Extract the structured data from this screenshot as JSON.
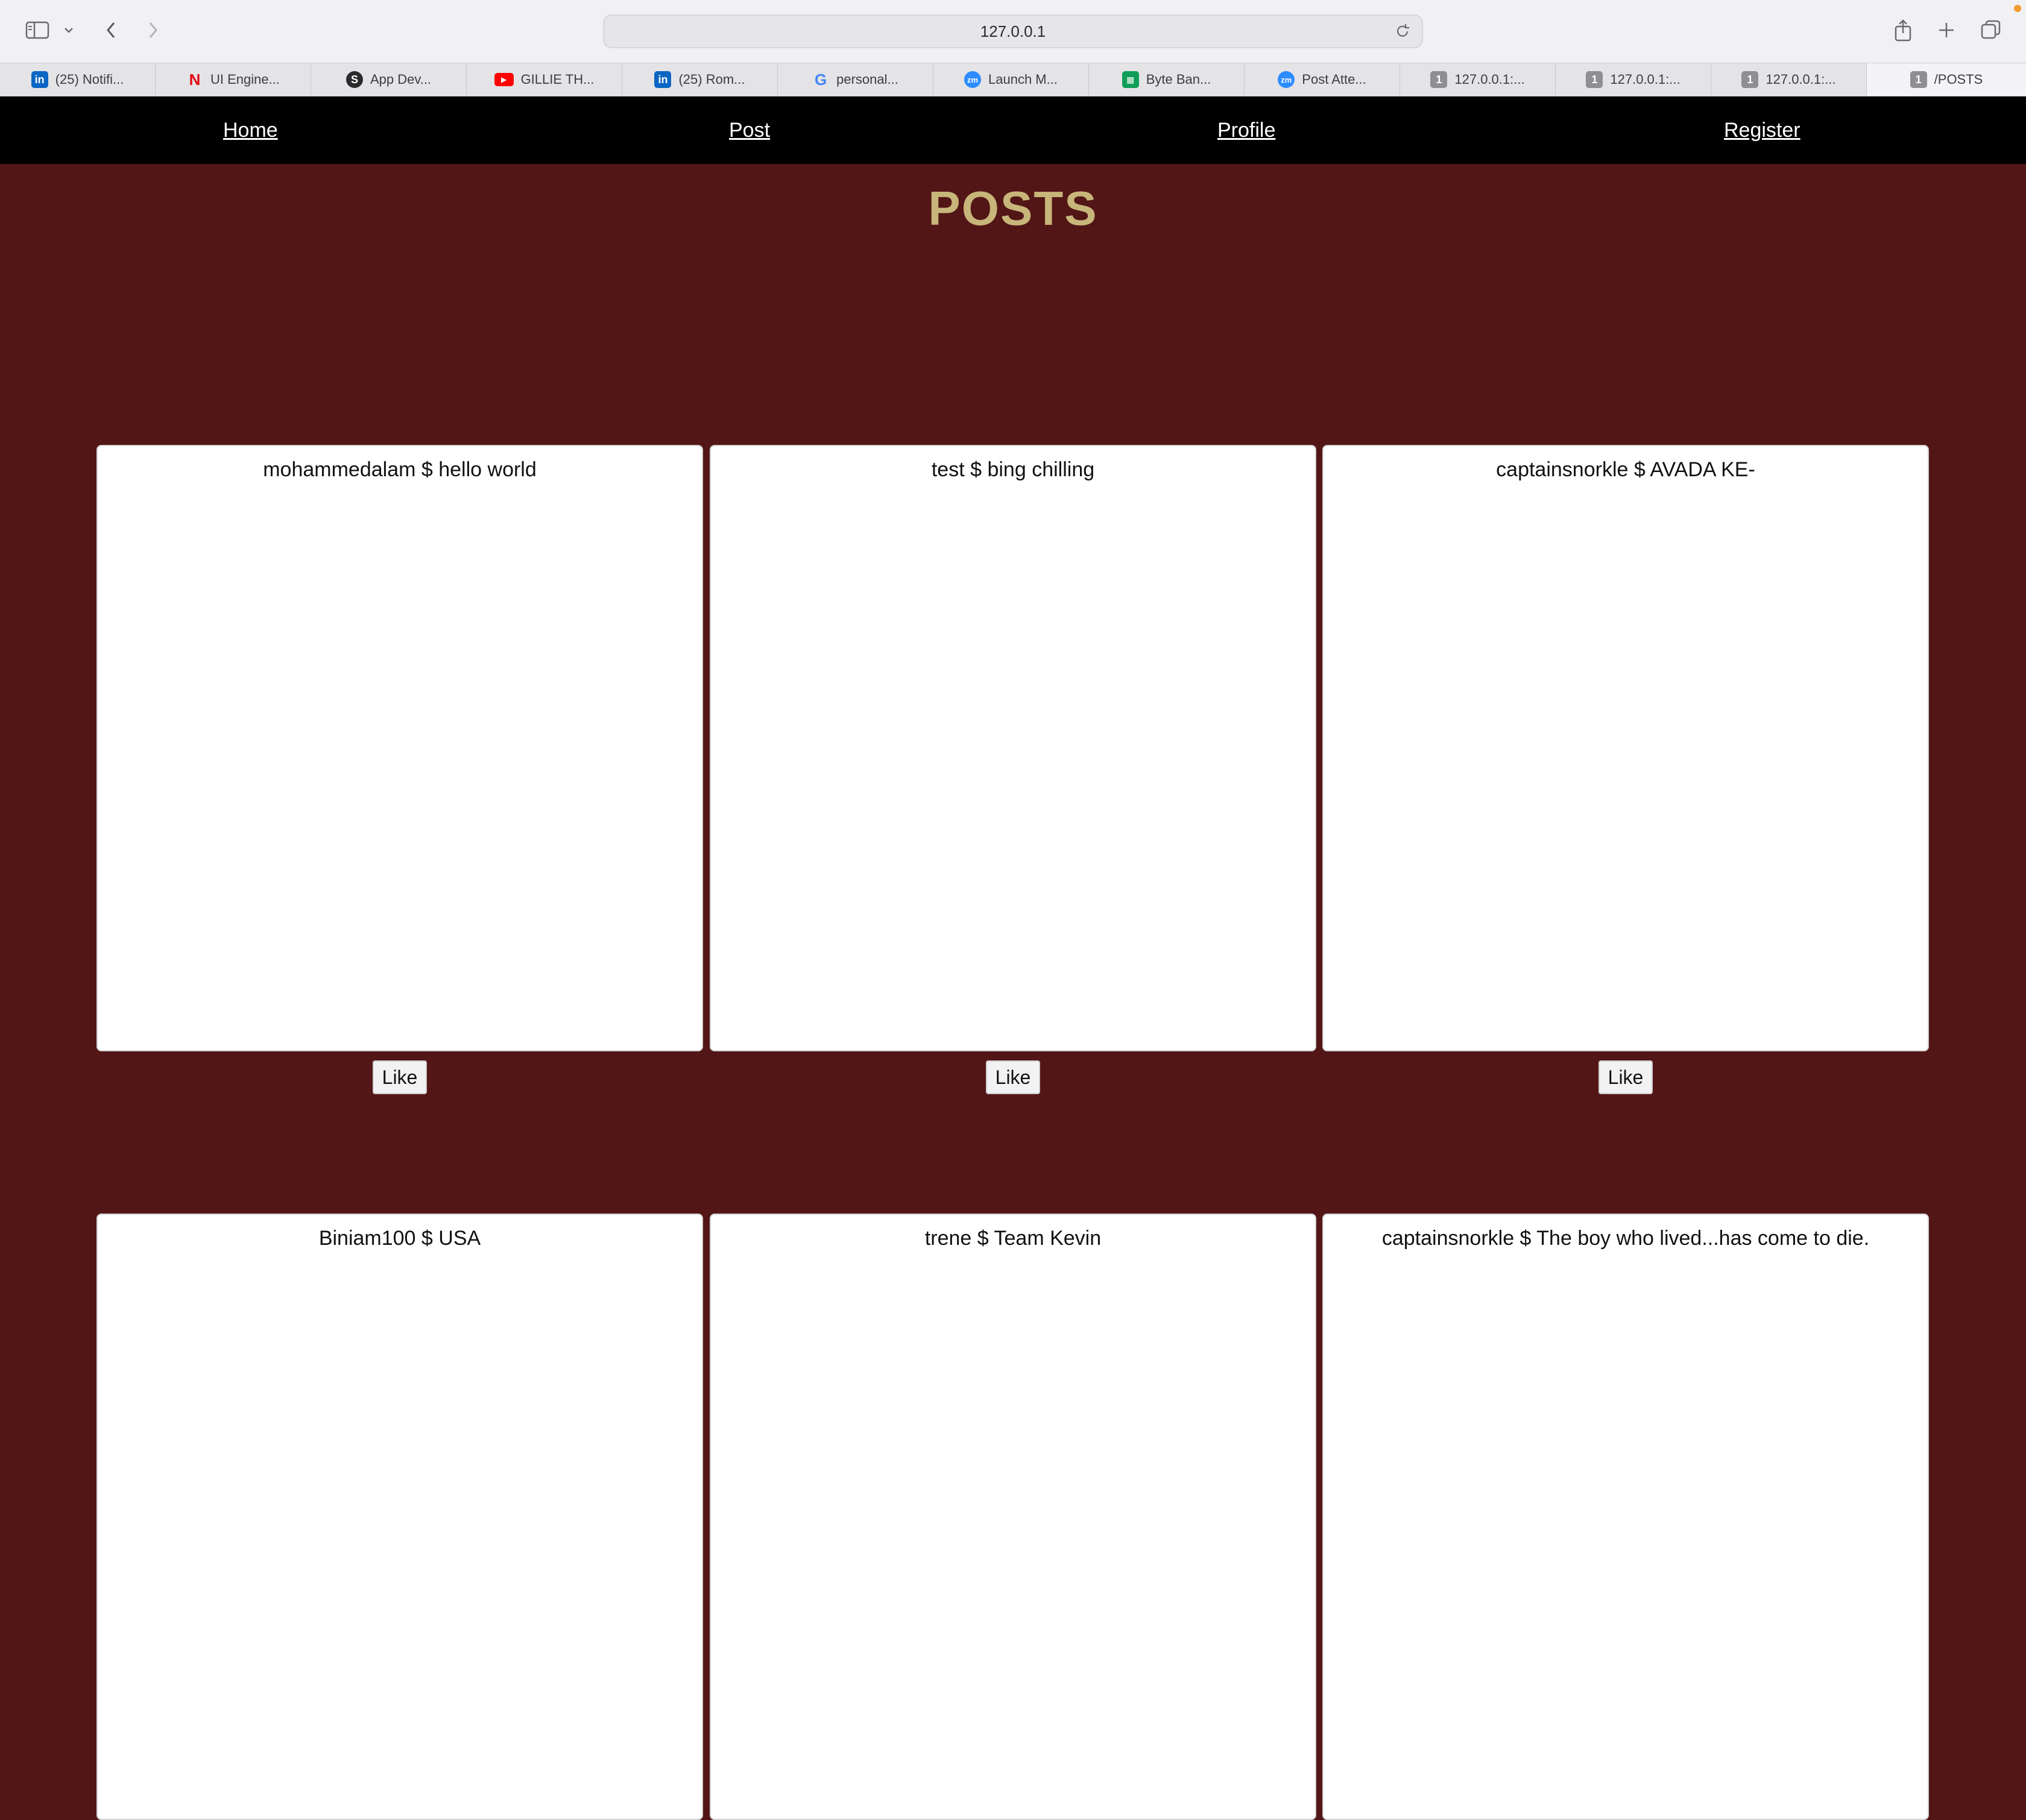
{
  "browser": {
    "url": "127.0.0.1",
    "tabs": [
      {
        "label": "(25) Notifi...",
        "icon": "linkedin-icon"
      },
      {
        "label": "UI Engine...",
        "icon": "netflix-icon"
      },
      {
        "label": "App Dev...",
        "icon": "s-circle-icon"
      },
      {
        "label": "GILLIE TH...",
        "icon": "youtube-icon"
      },
      {
        "label": "(25) Rom...",
        "icon": "linkedin-icon"
      },
      {
        "label": "personal...",
        "icon": "google-icon"
      },
      {
        "label": "Launch M...",
        "icon": "zoom-icon"
      },
      {
        "label": "Byte Ban...",
        "icon": "sheets-icon"
      },
      {
        "label": "Post Atte...",
        "icon": "zoom-icon"
      },
      {
        "label": "127.0.0.1:...",
        "icon": "one-badge-icon"
      },
      {
        "label": "127.0.0.1:...",
        "icon": "one-badge-icon"
      },
      {
        "label": "127.0.0.1:...",
        "icon": "one-badge-icon"
      },
      {
        "label": "/POSTS",
        "icon": "one-badge-icon"
      }
    ]
  },
  "nav": {
    "home": "Home",
    "post": "Post",
    "profile": "Profile",
    "register": "Register"
  },
  "page": {
    "title": "POSTS"
  },
  "posts": [
    {
      "title": "mohammedalam $ hello world",
      "like": "Like"
    },
    {
      "title": "test $ bing chilling",
      "like": "Like"
    },
    {
      "title": "captainsnorkle $ AVADA KE-",
      "like": "Like"
    },
    {
      "title": "Biniam100 $ USA"
    },
    {
      "title": "trene $ Team Kevin"
    },
    {
      "title": "captainsnorkle $ The boy who lived...has come to die."
    }
  ],
  "colors": {
    "page_bg": "#521616",
    "nav_bg": "#000000",
    "title": "#c7b57a",
    "linkedin": "#0a66c2",
    "netflix": "#e50914",
    "youtube": "#ff0000",
    "zoom": "#2d8cff",
    "sheets": "#0f9d58",
    "badge": "#8e8e93"
  }
}
